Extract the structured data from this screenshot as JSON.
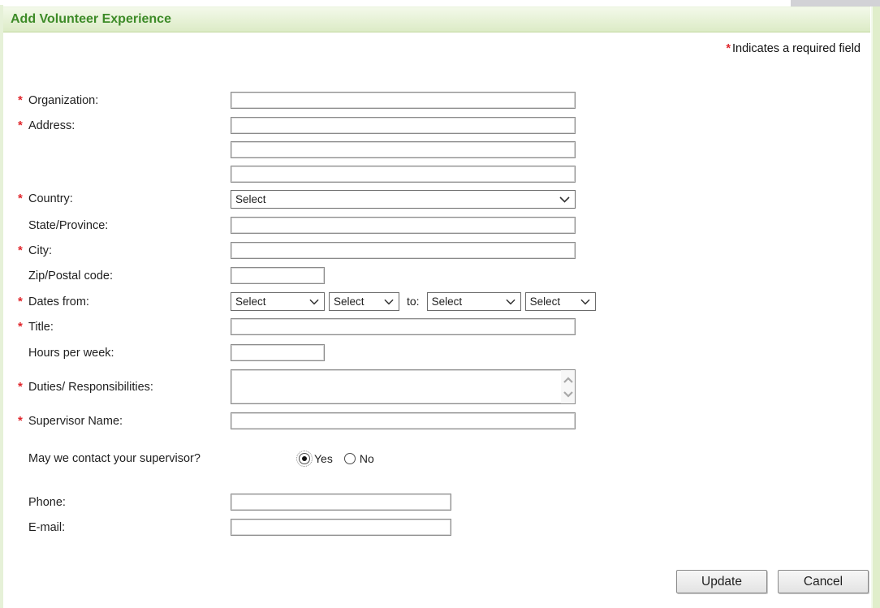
{
  "header": {
    "title": "Add Volunteer Experience"
  },
  "required_note": {
    "marker": "*",
    "text": "Indicates a required field"
  },
  "colors": {
    "accent_green": "#3d8b28",
    "required_red": "#e0262c",
    "header_bg_top": "#f3f9ea",
    "header_bg_bottom": "#dcebc6"
  },
  "fields": {
    "organization": {
      "label": "Organization:",
      "required": true,
      "value": ""
    },
    "address": {
      "label": "Address:",
      "required": true,
      "values": [
        "",
        "",
        ""
      ]
    },
    "country": {
      "label": "Country:",
      "required": true,
      "value": "Select"
    },
    "state": {
      "label": "State/Province:",
      "required": false,
      "value": ""
    },
    "city": {
      "label": "City:",
      "required": true,
      "value": ""
    },
    "zip": {
      "label": "Zip/Postal code:",
      "required": false,
      "value": ""
    },
    "dates": {
      "label": "Dates from:",
      "required": true,
      "from_month": "Select",
      "from_year": "Select",
      "to_label": "to:",
      "to_month": "Select",
      "to_year": "Select"
    },
    "title": {
      "label": "Title:",
      "required": true,
      "value": ""
    },
    "hours": {
      "label": "Hours per week:",
      "required": false,
      "value": ""
    },
    "duties": {
      "label": "Duties/ Responsibilities:",
      "required": true,
      "value": ""
    },
    "supervisor": {
      "label": "Supervisor Name:",
      "required": true,
      "value": ""
    },
    "contact": {
      "label": "May we contact your supervisor?",
      "options": [
        {
          "label": "Yes",
          "selected": true
        },
        {
          "label": "No",
          "selected": false
        }
      ]
    },
    "phone": {
      "label": "Phone:",
      "required": false,
      "value": ""
    },
    "email": {
      "label": "E-mail:",
      "required": false,
      "value": ""
    }
  },
  "buttons": {
    "update": "Update",
    "cancel": "Cancel"
  }
}
